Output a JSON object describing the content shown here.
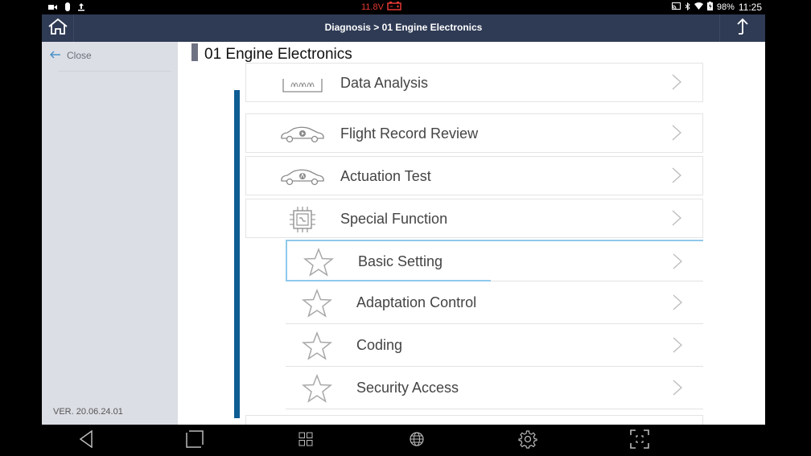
{
  "status_bar": {
    "voltage": "11.8V",
    "battery_percent": "98%",
    "time": "11:25",
    "left_icons": [
      "video-icon",
      "usb-device-icon",
      "upload-icon"
    ],
    "right_icons": [
      "cast-icon",
      "bluetooth-icon",
      "wifi-icon",
      "battery-charging-icon"
    ],
    "voltage_color": "#e53935"
  },
  "header": {
    "breadcrumb": "Diagnosis > 01 Engine Electronics",
    "home_icon": "home-icon",
    "share_icon": "share-upload-icon",
    "bg_color": "#2f3b55"
  },
  "sidebar": {
    "close_label": "Close",
    "version": "VER. 20.06.24.01"
  },
  "main": {
    "title": "01 Engine Electronics",
    "accent_color": "#0e5d94",
    "menu_items": [
      {
        "label": "Data Analysis",
        "icon": "waveform-icon"
      },
      {
        "label": "Flight Record Review",
        "icon": "car-record-icon"
      },
      {
        "label": "Actuation Test",
        "icon": "car-actuation-icon"
      },
      {
        "label": "Special Function",
        "icon": "chip-icon"
      }
    ],
    "sub_items": [
      {
        "label": "Basic Setting",
        "selected": true
      },
      {
        "label": "Adaptation Control",
        "selected": false
      },
      {
        "label": "Coding",
        "selected": false
      },
      {
        "label": "Security Access",
        "selected": false
      }
    ]
  },
  "navbar": {
    "buttons": [
      "back",
      "recents",
      "apps",
      "browser",
      "settings",
      "screenshot"
    ]
  }
}
